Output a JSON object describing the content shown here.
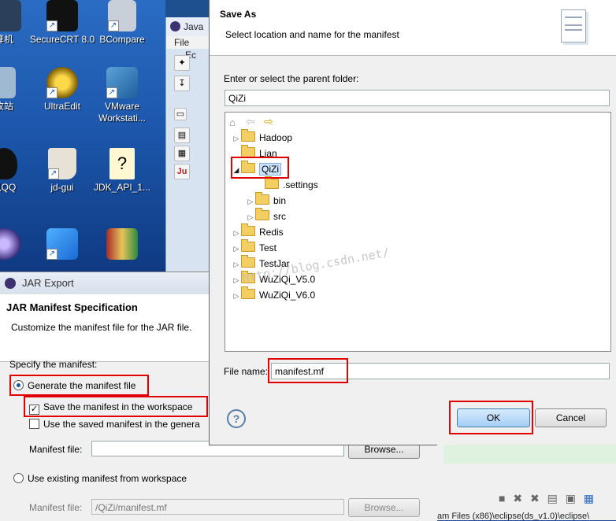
{
  "desktop": {
    "icons": [
      {
        "label": "算机"
      },
      {
        "label": "SecureCRT 8.0"
      },
      {
        "label": "BCompare"
      },
      {
        "label": "收站"
      },
      {
        "label": "UltraEdit"
      },
      {
        "label": "VMware Workstati..."
      },
      {
        "label": "讯QQ"
      },
      {
        "label": "jd-gui"
      },
      {
        "label": "JDK_API_1..."
      }
    ]
  },
  "eclipse": {
    "tab_label": "Java",
    "menu_file": "File",
    "menu_edit": "Ec"
  },
  "jar_export": {
    "window_title": "JAR Export",
    "heading": "JAR Manifest Specification",
    "description": "Customize the manifest file for the JAR file.",
    "specify_label": "Specify the manifest:",
    "generate_label": "Generate the manifest file",
    "save_in_workspace_label": "Save the manifest in the workspace",
    "use_saved_label": "Use the saved manifest in the genera",
    "manifest_file_label": "Manifest file:",
    "manifest_file_value": "",
    "browse_label": "Browse...",
    "use_existing_label": "Use existing manifest from workspace",
    "manifest_file_label2": "Manifest file:",
    "manifest_file_value2": "/QiZi/manifest.mf",
    "browse_label2": "Browse..."
  },
  "save_as": {
    "title": "Save As",
    "subtitle": "Select location and name for the manifest",
    "parent_label": "Enter or select the parent folder:",
    "parent_value": "QiZi",
    "tree": [
      {
        "label": "Hadoop"
      },
      {
        "label": "Lian"
      },
      {
        "label": "QiZi"
      },
      {
        "label": ".settings"
      },
      {
        "label": "bin"
      },
      {
        "label": "src"
      },
      {
        "label": "Redis"
      },
      {
        "label": "Test"
      },
      {
        "label": "TestJar"
      },
      {
        "label": "WuZiQi_V5.0"
      },
      {
        "label": "WuZiQi_V6.0"
      }
    ],
    "watermark": "http://blog.csdn.net/",
    "file_name_label": "File name:",
    "file_name_value": "manifest.mf",
    "ok_label": "OK",
    "cancel_label": "Cancel",
    "help_symbol": "?"
  },
  "status_fragment": {
    "path_text": "am Files (x86)\\eclipse(ds_v1.0)\\eclipse\\"
  },
  "colors": {
    "highlight_red": "#e00000",
    "ok_blue": "#3b7fd6"
  }
}
